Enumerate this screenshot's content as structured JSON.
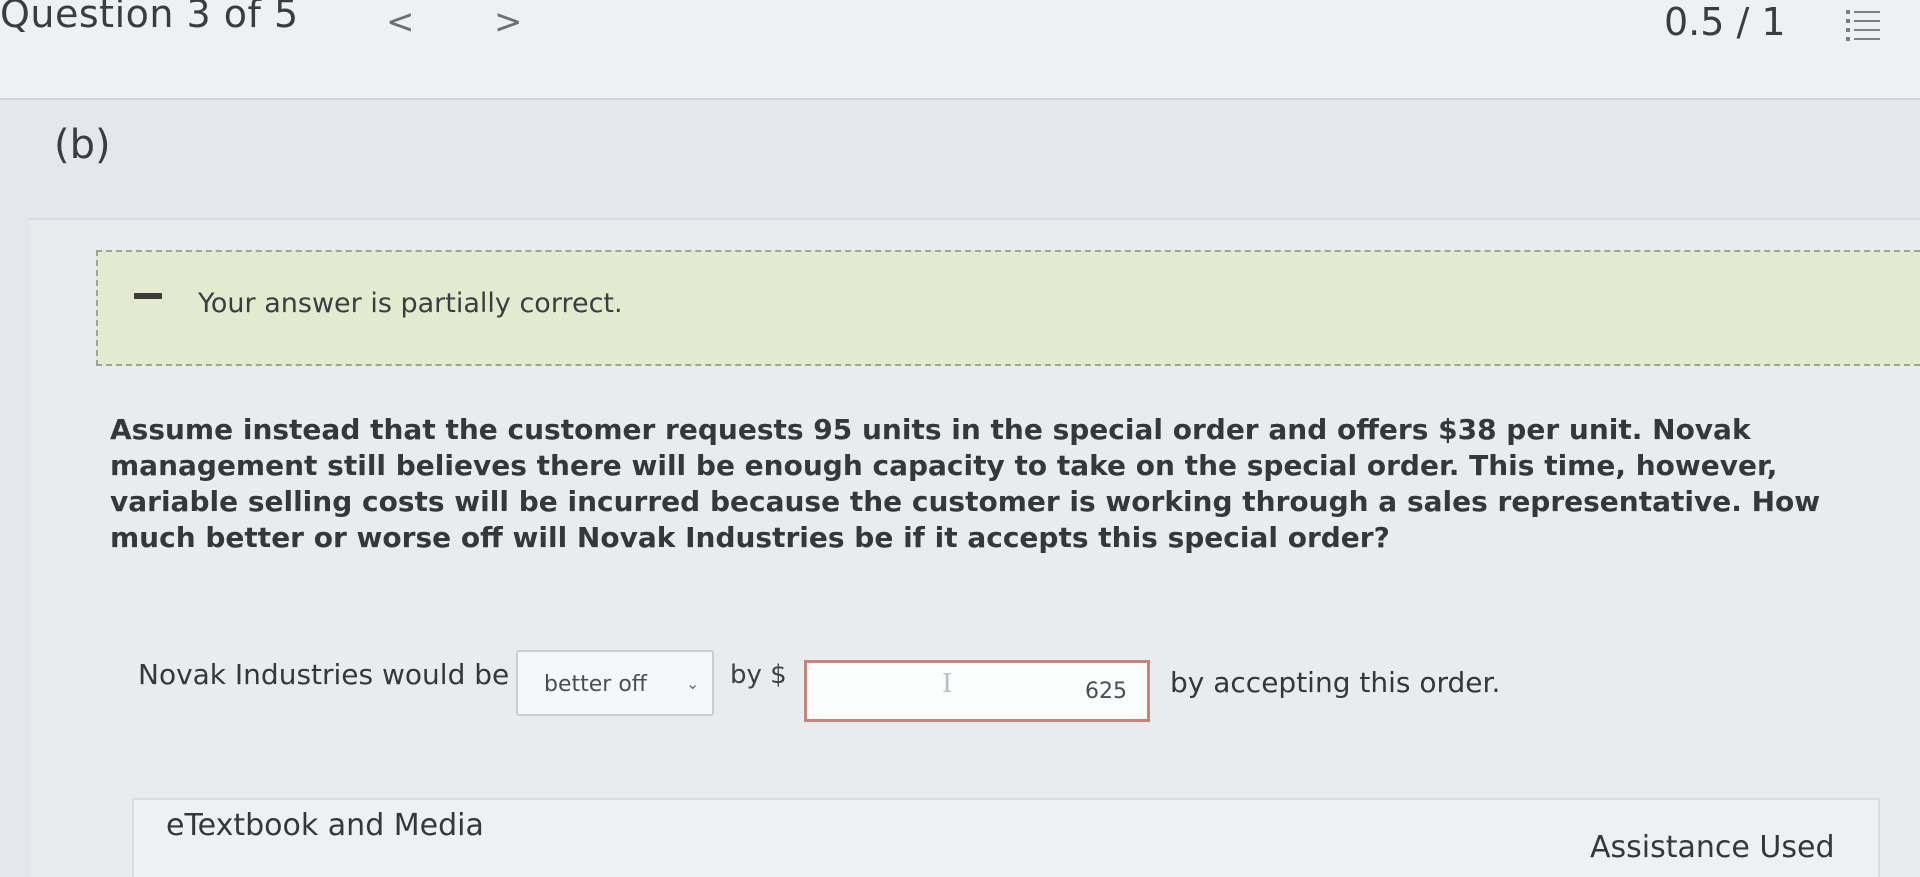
{
  "header": {
    "question_counter": "Question 3 of 5",
    "prev_icon": "<",
    "next_icon": ">",
    "score": "0.5 / 1",
    "list_icon": "list-icon"
  },
  "part": {
    "label": "(b)"
  },
  "feedback": {
    "message": "Your answer is partially correct."
  },
  "question": {
    "text": "Assume instead that the customer requests 95 units in the special order and offers $38 per unit. Novak management still believes there will be enough capacity to take on the special order. This time, however, variable selling costs will be incurred because the customer is working through a sales representative. How much better or worse off will Novak Industries be if it accepts this special order?"
  },
  "answer": {
    "prefix": "Novak Industries would be",
    "dropdown_value": "better off",
    "by_label": "by $",
    "amount_value": "625",
    "suffix": "by accepting this order."
  },
  "resources": {
    "etextbook_label": "eTextbook and Media",
    "assistance_label": "Assistance Used"
  }
}
